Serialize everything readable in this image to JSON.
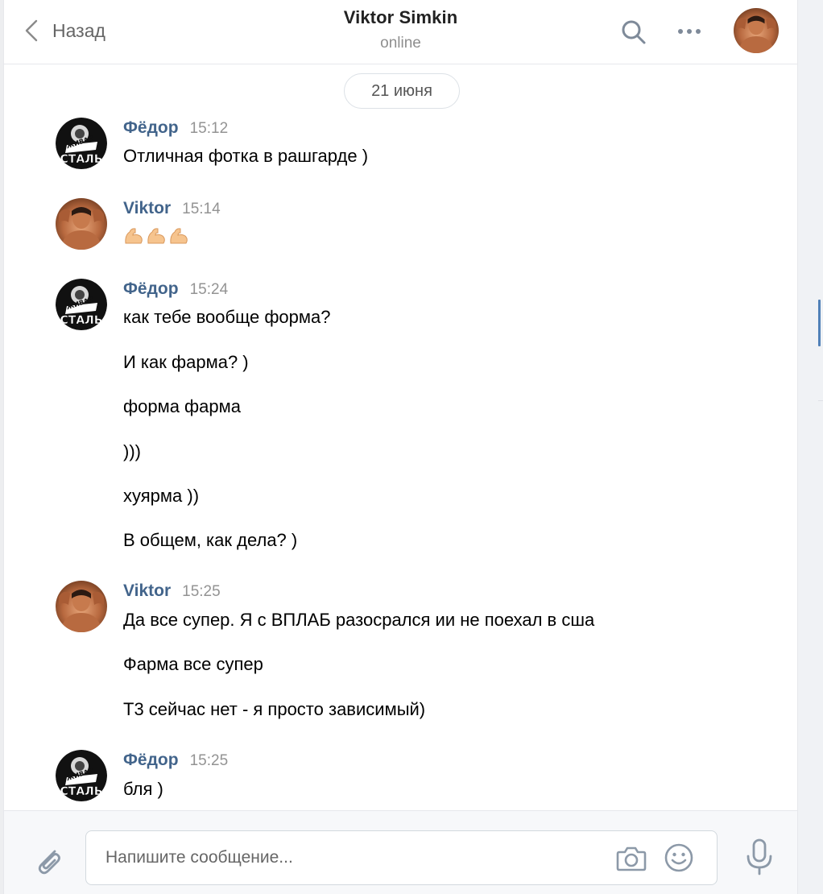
{
  "header": {
    "back_label": "Назад",
    "title": "Viktor Simkin",
    "status": "online",
    "icons": [
      "chevron-left-icon",
      "search-icon",
      "more-icon"
    ]
  },
  "date_separator": "21 июня",
  "messages": [
    {
      "author": "Фёдор",
      "time": "15:12",
      "lines": [
        "Отличная фотка в рашгарде )"
      ]
    },
    {
      "author": "Viktor",
      "time": "15:14",
      "emoji": [
        "flexed-biceps",
        "flexed-biceps",
        "flexed-biceps"
      ]
    },
    {
      "author": "Фёдор",
      "time": "15:24",
      "lines": [
        "как тебе вообще форма?",
        "И как фарма? )",
        "форма фарма",
        ")))",
        "хуярма ))",
        "В общем, как дела? )"
      ]
    },
    {
      "author": "Viktor",
      "time": "15:25",
      "lines": [
        "Да все супер. Я с ВПЛАБ разосрался ии не поехал в сша",
        "Фарма все супер",
        "Т3 сейчас нет - я просто зависимый)"
      ]
    },
    {
      "author": "Фёдор",
      "time": "15:25",
      "lines": [
        "бля )"
      ]
    }
  ],
  "avatar_logo_text": {
    "top": "ЖИВАЯ",
    "bottom": "СТАЛЬ"
  },
  "composer": {
    "placeholder": "Напишите сообщение...",
    "icons": [
      "paperclip-icon",
      "camera-icon",
      "smile-icon",
      "microphone-icon"
    ]
  },
  "colors": {
    "author": "#42648b",
    "time": "#939393",
    "accent": "#5181b8",
    "page_bg": "#edeef0"
  }
}
